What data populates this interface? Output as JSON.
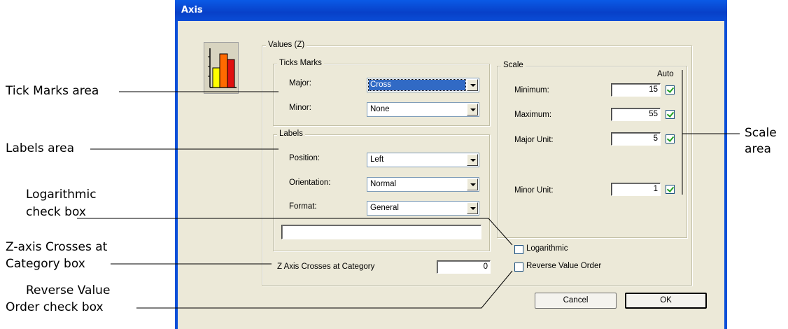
{
  "dialog": {
    "title": "Axis",
    "values_group": "Values (Z)",
    "ticks": {
      "legend": "Ticks Marks",
      "major_label": "Major:",
      "major_value": "Cross",
      "minor_label": "Minor:",
      "minor_value": "None"
    },
    "labels": {
      "legend": "Labels",
      "position_label": "Position:",
      "position_value": "Left",
      "orientation_label": "Orientation:",
      "orientation_value": "Normal",
      "format_label": "Format:",
      "format_value": "General",
      "format_text": ""
    },
    "scale": {
      "legend": "Scale",
      "auto_label": "Auto",
      "minimum_label": "Minimum:",
      "minimum_value": "15",
      "maximum_label": "Maximum:",
      "maximum_value": "55",
      "major_unit_label": "Major Unit:",
      "major_unit_value": "5",
      "minor_unit_label": "Minor Unit:",
      "minor_unit_value": "1"
    },
    "logarithmic_label": "Logarithmic",
    "reverse_label": "Reverse Value Order",
    "crosses_label": "Z Axis Crosses at Category",
    "crosses_value": "0",
    "cancel_label": "Cancel",
    "ok_label": "OK"
  },
  "callouts": {
    "tick_marks": "Tick Marks area",
    "labels": "Labels area",
    "logarithmic_1": "Logarithmic",
    "logarithmic_2": "check box",
    "crosses_1": "Z-axis Crosses at",
    "crosses_2": "Category box",
    "reverse_1": "Reverse Value",
    "reverse_2": "Order check box",
    "scale_1": "Scale",
    "scale_2": "area"
  },
  "colors": {
    "dialog_bg": "#ece9d8",
    "titlebar": "#0a4fd8",
    "selection": "#316ac5"
  }
}
